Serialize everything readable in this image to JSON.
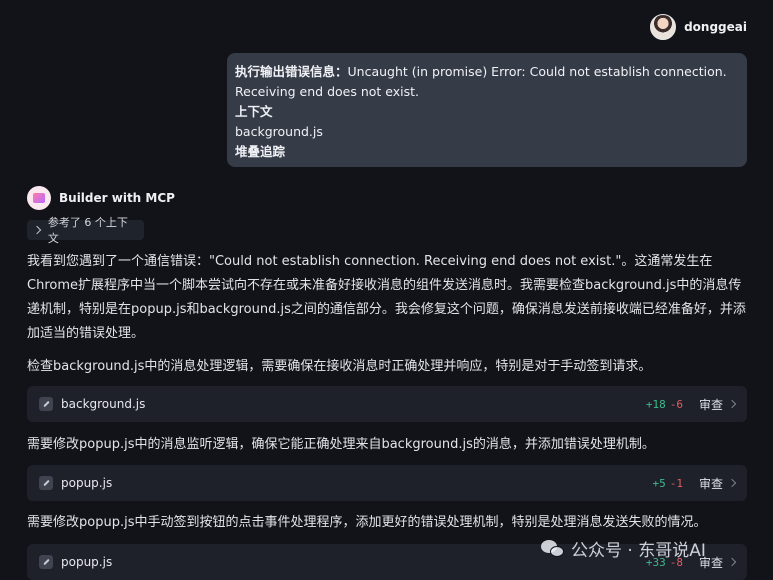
{
  "user": {
    "name": "donggeai",
    "message": {
      "line1_label": "执行输出错误信息：",
      "line1_text": "Uncaught (in promise) Error: Could not establish connection.",
      "line2": "Receiving end does not exist.",
      "line3": "上下文",
      "line4": "background.js",
      "line5": "堆叠追踪"
    }
  },
  "assistant": {
    "name": "Builder with MCP",
    "context_chip": "参考了 6 个上下文",
    "intro": "我看到您遇到了一个通信错误：\"Could not establish connection. Receiving end does not exist.\"。这通常发生在Chrome扩展程序中当一个脚本尝试向不存在或未准备好接收消息的组件发送消息时。我需要检查background.js中的消息传递机制，特别是在popup.js和background.js之间的通信部分。我会修复这个问题，确保消息发送前接收端已经准备好，并添加适当的错误处理。",
    "steps": [
      {
        "text": "检查background.js中的消息处理逻辑，需要确保在接收消息时正确处理并响应，特别是对于手动签到请求。",
        "file": "background.js",
        "added": "+18",
        "removed": "-6",
        "action": "审查"
      },
      {
        "text": "需要修改popup.js中的消息监听逻辑，确保它能正确处理来自background.js的消息，并添加错误处理机制。",
        "file": "popup.js",
        "added": "+5",
        "removed": "-1",
        "action": "审查"
      },
      {
        "text": "需要修改popup.js中手动签到按钮的点击事件处理程序，添加更好的错误处理机制，特别是处理消息发送失败的情况。",
        "file": "popup.js",
        "added": "+33",
        "removed": "-8",
        "action": "审查"
      }
    ]
  },
  "watermark": "公众号 · 东哥说AI"
}
